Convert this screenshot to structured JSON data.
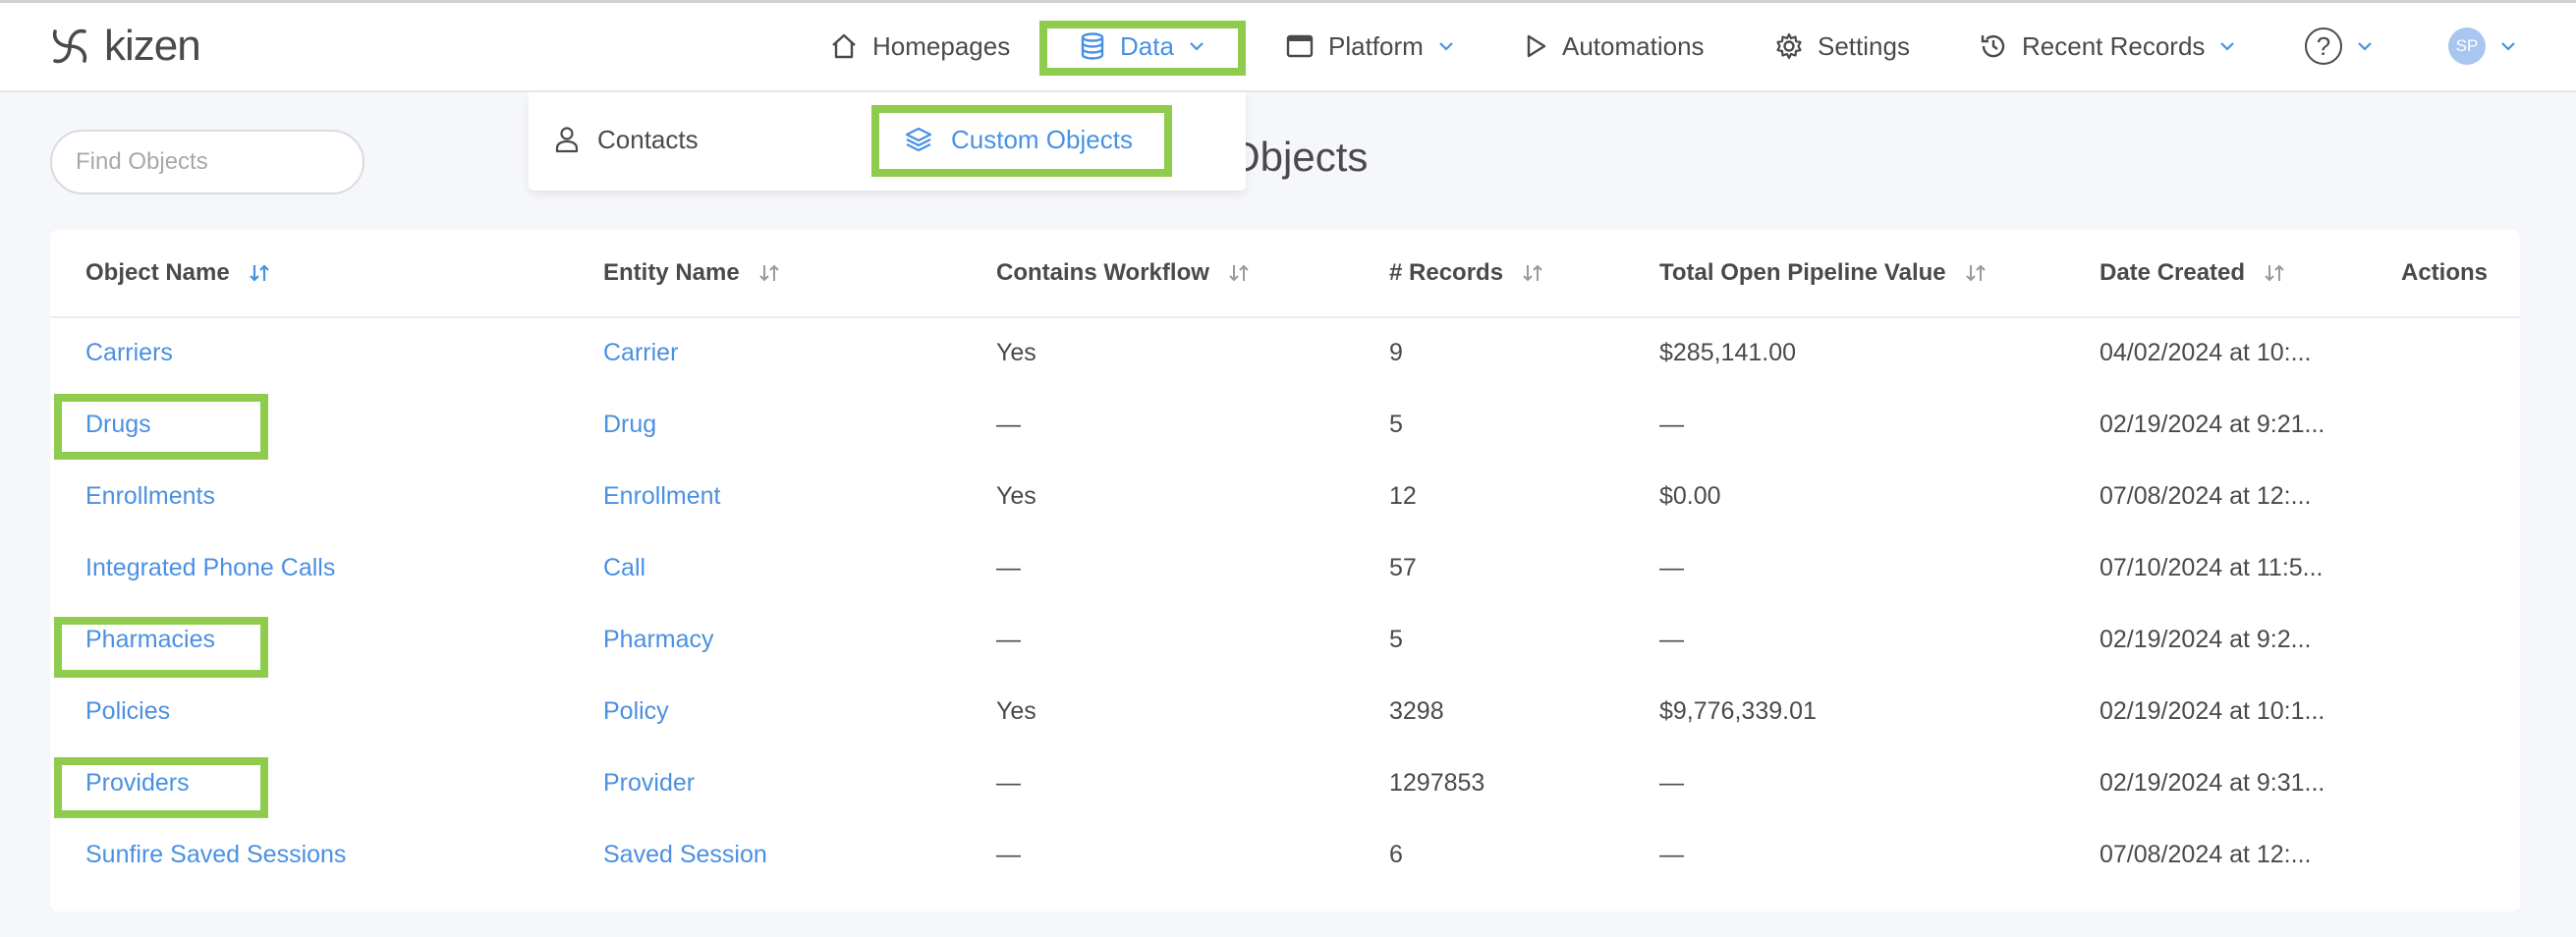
{
  "app": {
    "logo_text": "kizen"
  },
  "nav": {
    "homepages": "Homepages",
    "data": "Data",
    "platform": "Platform",
    "automations": "Automations",
    "settings": "Settings",
    "recent_records": "Recent Records",
    "help": "?",
    "avatar_initials": "SP"
  },
  "data_menu": {
    "contacts": "Contacts",
    "custom_objects": "Custom Objects"
  },
  "search": {
    "placeholder": "Find Objects",
    "value": ""
  },
  "page": {
    "title_visible": "Objects"
  },
  "table": {
    "headers": [
      "Object Name",
      "Entity Name",
      "Contains Workflow",
      "# Records",
      "Total Open Pipeline Value",
      "Date Created",
      "Actions"
    ],
    "rows": [
      {
        "object_name": "Carriers",
        "entity_name": "Carrier",
        "contains_workflow": "Yes",
        "records": "9",
        "pipeline_value": "$285,141.00",
        "date_created": "04/02/2024 at 10:..."
      },
      {
        "object_name": "Drugs",
        "entity_name": "Drug",
        "contains_workflow": "—",
        "records": "5",
        "pipeline_value": "—",
        "date_created": "02/19/2024 at 9:21..."
      },
      {
        "object_name": "Enrollments",
        "entity_name": "Enrollment",
        "contains_workflow": "Yes",
        "records": "12",
        "pipeline_value": "$0.00",
        "date_created": "07/08/2024 at 12:..."
      },
      {
        "object_name": "Integrated Phone Calls",
        "entity_name": "Call",
        "contains_workflow": "—",
        "records": "57",
        "pipeline_value": "—",
        "date_created": "07/10/2024 at 11:5..."
      },
      {
        "object_name": "Pharmacies",
        "entity_name": "Pharmacy",
        "contains_workflow": "—",
        "records": "5",
        "pipeline_value": "—",
        "date_created": "02/19/2024 at 9:2..."
      },
      {
        "object_name": "Policies",
        "entity_name": "Policy",
        "contains_workflow": "Yes",
        "records": "3298",
        "pipeline_value": "$9,776,339.01",
        "date_created": "02/19/2024 at 10:1..."
      },
      {
        "object_name": "Providers",
        "entity_name": "Provider",
        "contains_workflow": "—",
        "records": "1297853",
        "pipeline_value": "—",
        "date_created": "02/19/2024 at 9:31..."
      },
      {
        "object_name": "Sunfire Saved Sessions",
        "entity_name": "Saved Session",
        "contains_workflow": "—",
        "records": "6",
        "pipeline_value": "—",
        "date_created": "07/08/2024 at 12:..."
      }
    ]
  },
  "colors": {
    "link": "#4a90e2",
    "highlight": "#8fcc4e",
    "text": "#4a4a4a",
    "background": "#f6f7fb"
  },
  "icons": {
    "logo": "kizen-logo-icon",
    "home": "home-icon",
    "data": "database-icon",
    "platform": "window-icon",
    "automations": "play-icon",
    "settings": "gear-icon",
    "recent": "history-icon",
    "help": "help-circle-icon",
    "chevron": "chevron-down-icon",
    "contacts": "person-icon",
    "custom_objects": "layers-icon",
    "search": "search-icon",
    "sort": "sort-arrows-icon"
  }
}
